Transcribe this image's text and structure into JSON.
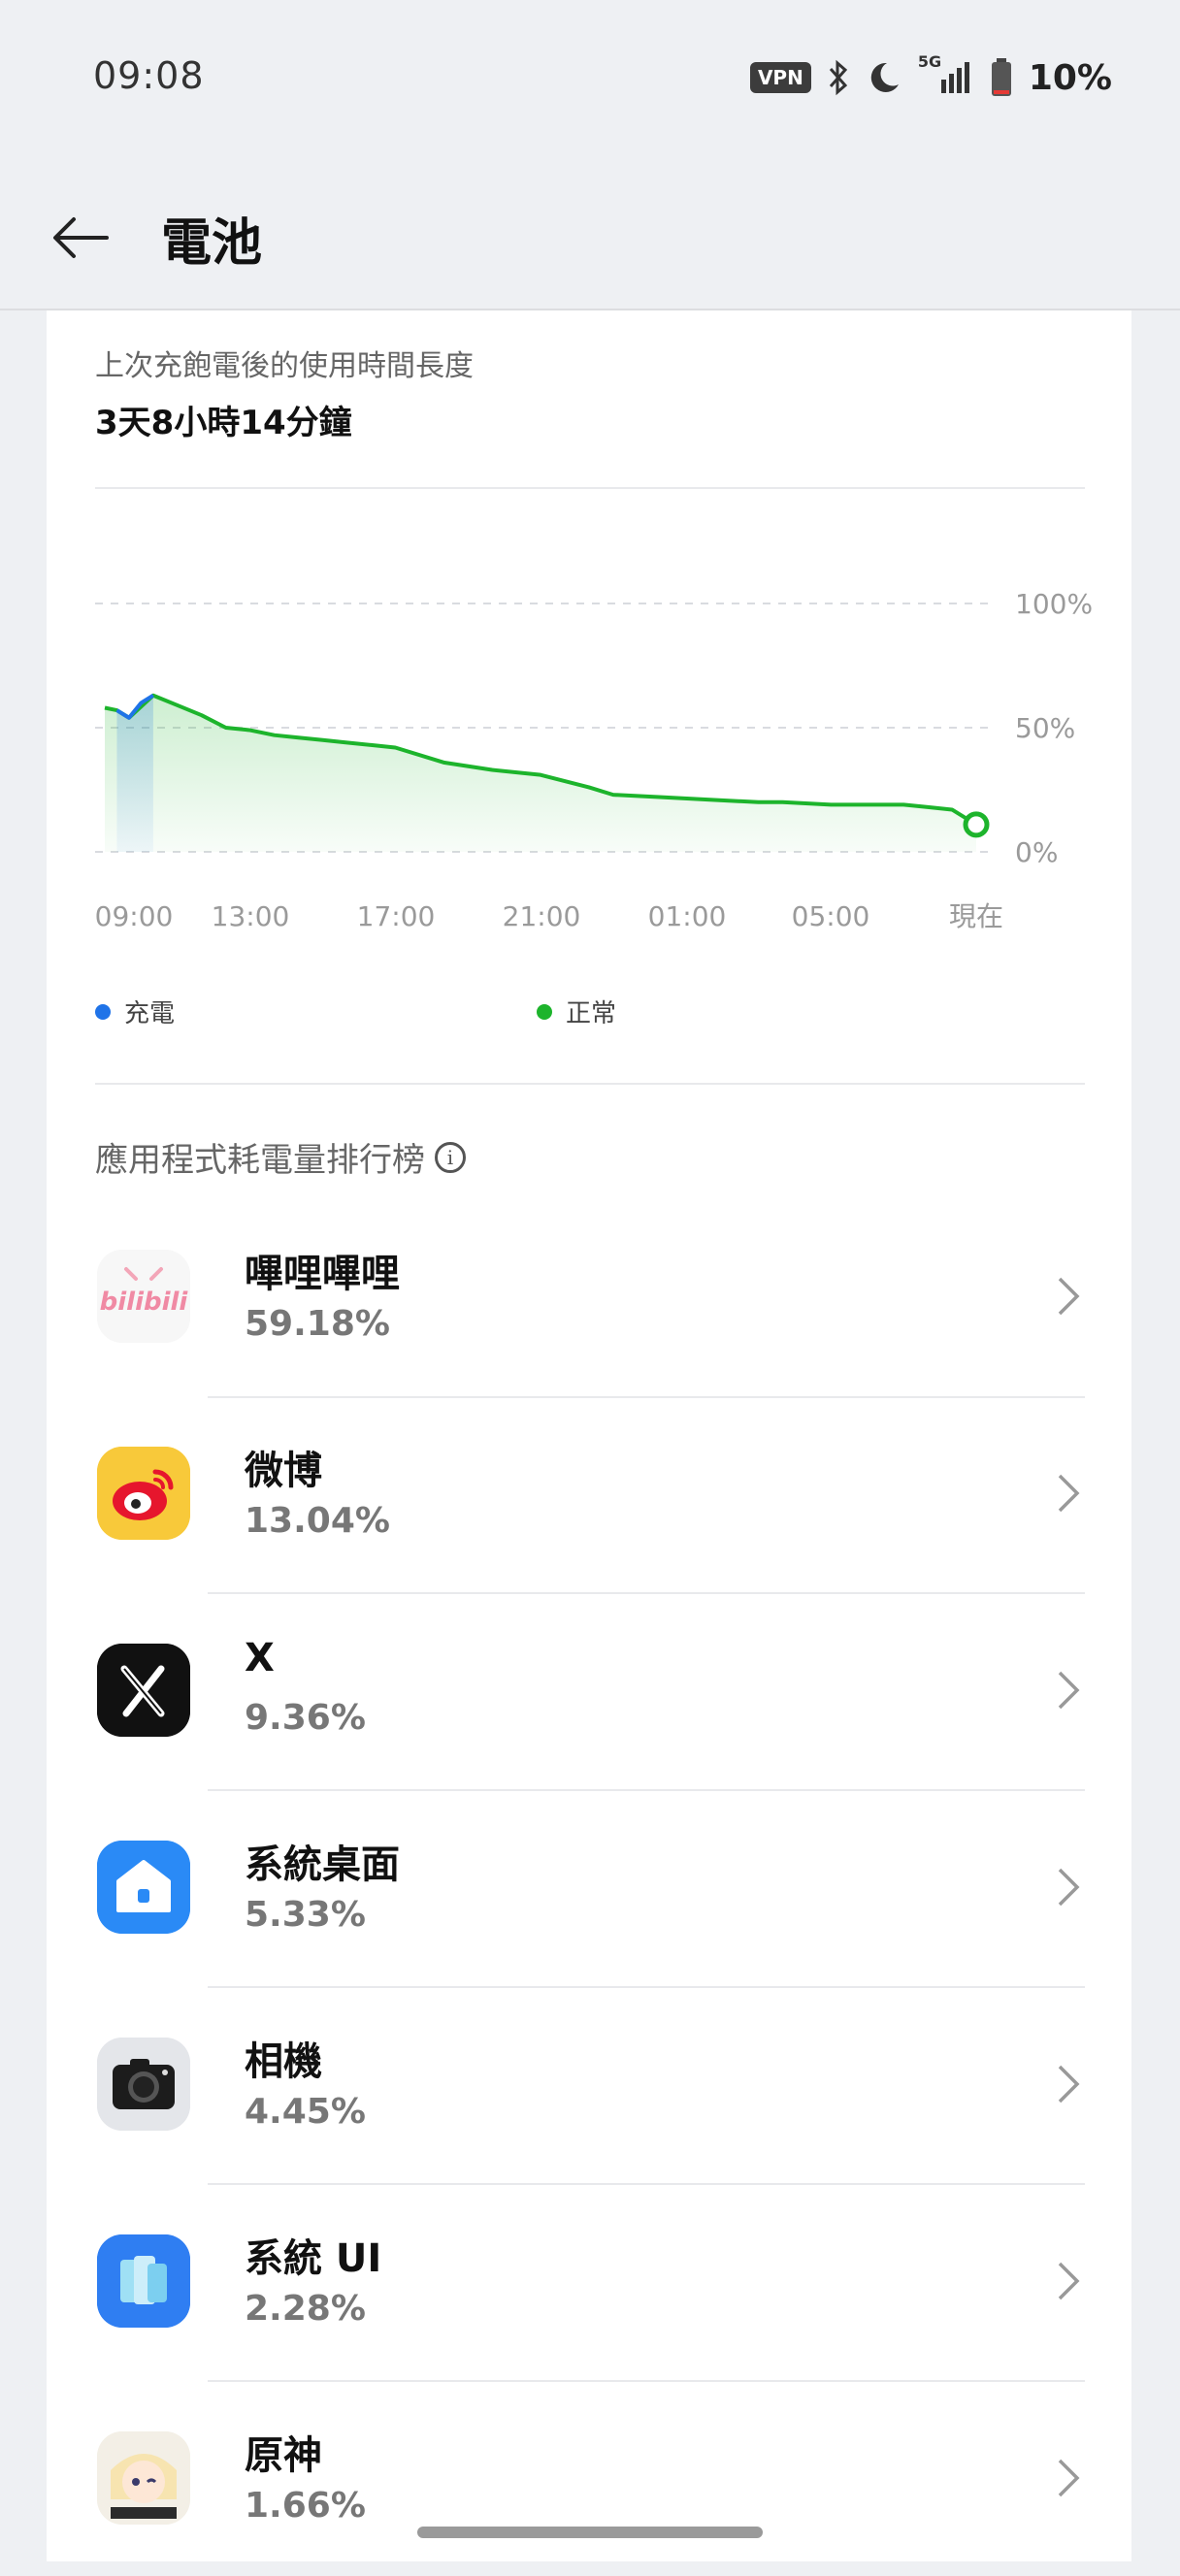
{
  "status_bar": {
    "time": "09:08",
    "vpn_label": "VPN",
    "network": "5G",
    "battery": "10%",
    "icons": [
      "vpn-icon",
      "bluetooth-icon",
      "moon-icon",
      "signal-icon",
      "battery-icon"
    ]
  },
  "header": {
    "title": "電池",
    "back_icon": "arrow-left-icon"
  },
  "usage": {
    "label": "上次充飽電後的使用時間長度",
    "value": "3天8小時14分鐘"
  },
  "chart_data": {
    "type": "area",
    "y_ticks": [
      "100%",
      "50%",
      "0%"
    ],
    "x_ticks": [
      "09:00",
      "13:00",
      "17:00",
      "21:00",
      "01:00",
      "05:00",
      "現在"
    ],
    "ylim": [
      0,
      100
    ],
    "grid": true,
    "series": [
      {
        "name": "充電",
        "color": "#1f73e8",
        "points": [
          [
            0.5,
            57
          ],
          [
            1.0,
            54
          ],
          [
            1.5,
            60
          ],
          [
            2.0,
            63
          ]
        ]
      },
      {
        "name": "正常",
        "color": "#1db42c",
        "points": [
          [
            0,
            58
          ],
          [
            0.5,
            57
          ],
          [
            1.0,
            54
          ],
          [
            2.0,
            63
          ],
          [
            3.0,
            59
          ],
          [
            4.0,
            55
          ],
          [
            5.0,
            50
          ],
          [
            6.0,
            49
          ],
          [
            7.0,
            47
          ],
          [
            8.0,
            46
          ],
          [
            9.0,
            45
          ],
          [
            10.0,
            44
          ],
          [
            11.0,
            43
          ],
          [
            12.0,
            42
          ],
          [
            14.0,
            36
          ],
          [
            16.0,
            33
          ],
          [
            18.0,
            31
          ],
          [
            20.0,
            26
          ],
          [
            21.0,
            23
          ],
          [
            23.0,
            22
          ],
          [
            25.0,
            21
          ],
          [
            27.0,
            20
          ],
          [
            28.0,
            20
          ],
          [
            30.0,
            19
          ],
          [
            32.0,
            19
          ],
          [
            33.0,
            19
          ],
          [
            34.0,
            18
          ],
          [
            35.0,
            17
          ],
          [
            36.0,
            11
          ]
        ]
      }
    ],
    "x_range_hours": [
      0,
      36
    ],
    "legend_position": "bottom"
  },
  "legend": [
    {
      "label": "充電",
      "color": "#1f73e8"
    },
    {
      "label": "正常",
      "color": "#1db42c"
    }
  ],
  "ranking": {
    "title": "應用程式耗電量排行榜",
    "info_icon": "info-icon",
    "apps": [
      {
        "name": "嗶哩嗶哩",
        "percent": "59.18%",
        "icon": "bilibili-icon"
      },
      {
        "name": "微博",
        "percent": "13.04%",
        "icon": "weibo-icon"
      },
      {
        "name": "X",
        "percent": "9.36%",
        "icon": "x-icon"
      },
      {
        "name": "系統桌面",
        "percent": "5.33%",
        "icon": "launcher-icon"
      },
      {
        "name": "相機",
        "percent": "4.45%",
        "icon": "camera-icon"
      },
      {
        "name": "系統 UI",
        "percent": "2.28%",
        "icon": "system-ui-icon"
      },
      {
        "name": "原神",
        "percent": "1.66%",
        "icon": "genshin-icon"
      }
    ]
  }
}
